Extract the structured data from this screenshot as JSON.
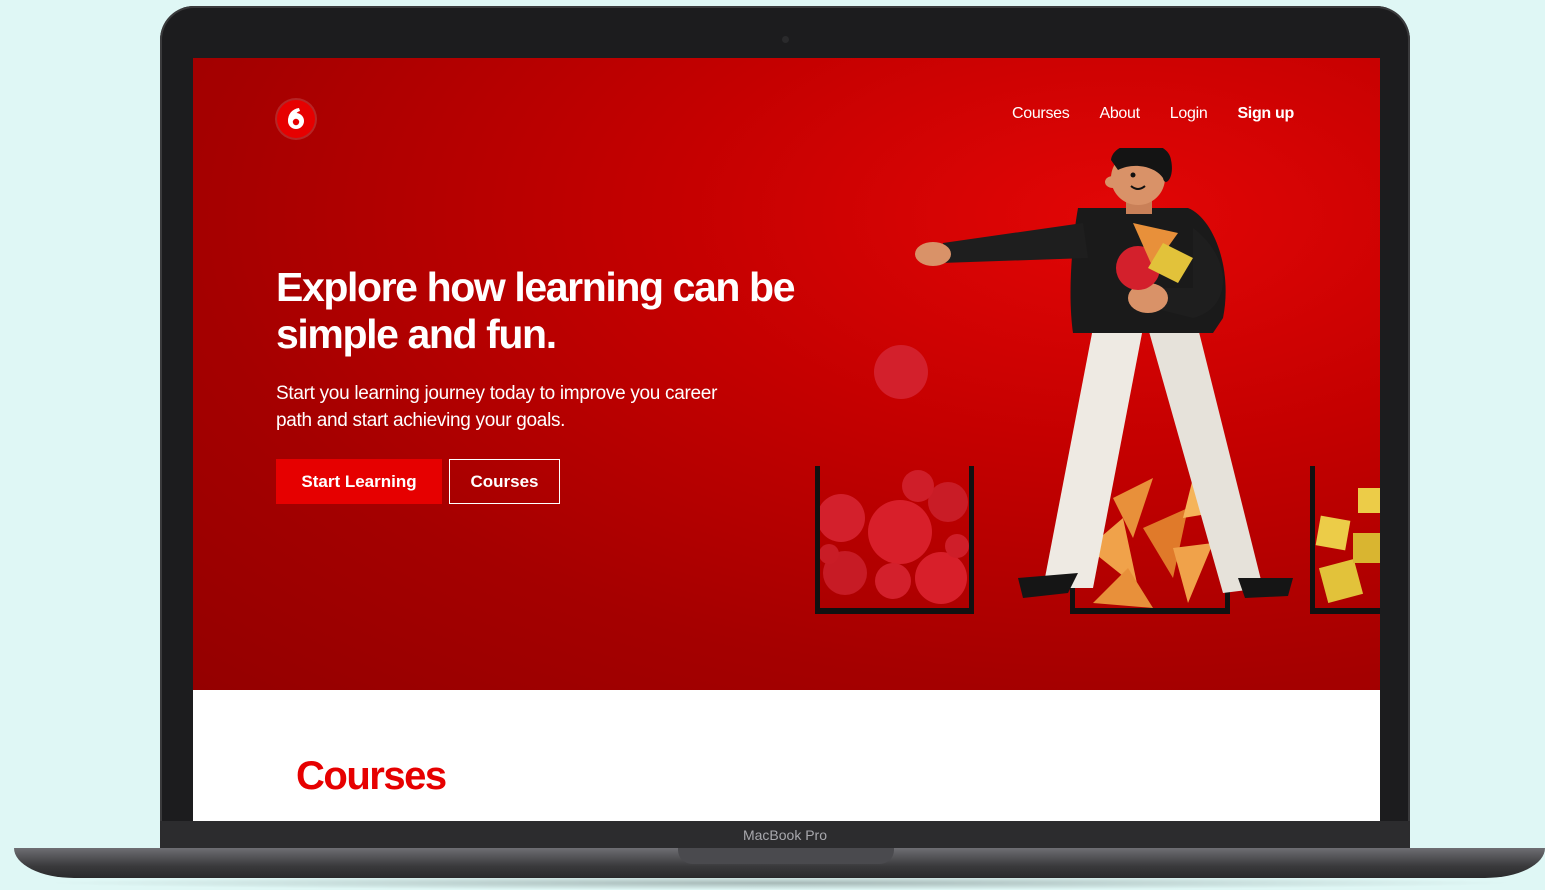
{
  "colors": {
    "brand_red": "#e60000",
    "hero_dark": "#940000",
    "background": "#dff7f5"
  },
  "device": {
    "label": "MacBook Pro"
  },
  "nav": {
    "logo_icon": "vodafone-logo-icon",
    "items": [
      {
        "label": "Courses"
      },
      {
        "label": "About"
      },
      {
        "label": "Login"
      },
      {
        "label": "Sign up"
      }
    ]
  },
  "hero": {
    "headline": "Explore how learning can be simple and fun.",
    "subtext": "Start you learning journey today to improve you career path and start achieving your goals.",
    "primary_button": "Start Learning",
    "secondary_button": "Courses",
    "illustration_icon": "person-sorting-shapes-illustration"
  },
  "courses_section": {
    "title": "Courses"
  }
}
